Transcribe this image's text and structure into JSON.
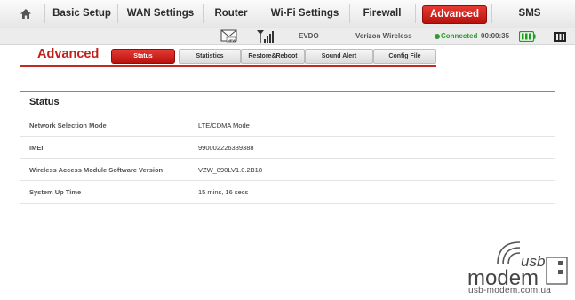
{
  "nav": {
    "items": [
      "Basic Setup",
      "WAN Settings",
      "Router",
      "Wi-Fi Settings",
      "Firewall",
      "Advanced",
      "SMS"
    ]
  },
  "statusbar": {
    "network_type": "EVDO",
    "carrier": "Verizon Wireless",
    "connection": "Connected",
    "timer": "00:00:35",
    "new_badge": "NEW"
  },
  "page": {
    "title": "Advanced",
    "tabs": [
      "Status",
      "Statistics",
      "Restore&Reboot",
      "Sound Alert",
      "Config File"
    ]
  },
  "section": {
    "title": "Status",
    "rows": [
      {
        "label": "Network Selection Mode",
        "value": "LTE/CDMA Mode"
      },
      {
        "label": "IMEI",
        "value": "990002226339388"
      },
      {
        "label": "Wireless Access Module Software Version",
        "value": "VZW_890LV1.0.2B18"
      },
      {
        "label": "System Up Time",
        "value": "15 mins, 16 secs"
      }
    ]
  },
  "watermark": {
    "logo_top": "usb",
    "logo_bottom": "modem",
    "url": "usb-modem.com.ua"
  },
  "colors": {
    "accent": "#c0201a",
    "connected": "#2e9c2e",
    "battery": "#1e9c1e"
  }
}
